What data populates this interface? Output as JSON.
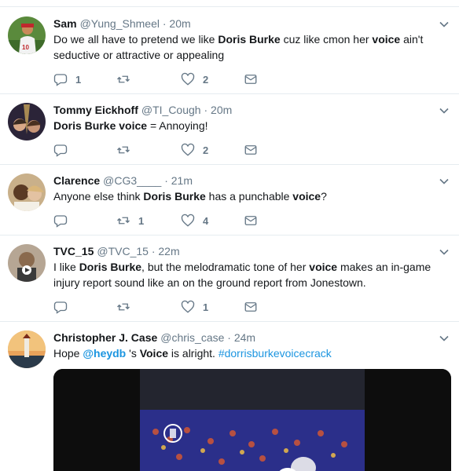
{
  "tweets": [
    {
      "name": "Sam",
      "handle": "@Yung_Shmeel",
      "time": "20m",
      "parts": [
        {
          "t": "Do we all have to pretend we like "
        },
        {
          "t": "Doris Burke",
          "b": true
        },
        {
          "t": " cuz like cmon her "
        },
        {
          "t": "voice",
          "b": true
        },
        {
          "t": " ain't seductive or attractive or appealing"
        }
      ],
      "replies": "1",
      "retweets": "",
      "likes": "2"
    },
    {
      "name": "Tommy Eickhoff",
      "handle": "@TI_Cough",
      "time": "20m",
      "parts": [
        {
          "t": "Doris Burke voice",
          "b": true
        },
        {
          "t": " = Annoying!"
        }
      ],
      "replies": "",
      "retweets": "",
      "likes": "2"
    },
    {
      "name": "Clarence",
      "handle": "@CG3____",
      "time": "21m",
      "parts": [
        {
          "t": "Anyone else think "
        },
        {
          "t": "Doris Burke",
          "b": true
        },
        {
          "t": " has a punchable "
        },
        {
          "t": "voice",
          "b": true
        },
        {
          "t": "?"
        }
      ],
      "replies": "",
      "retweets": "1",
      "likes": "4"
    },
    {
      "name": "TVC_15",
      "handle": "@TVC_15",
      "time": "22m",
      "parts": [
        {
          "t": "I like "
        },
        {
          "t": "Doris Burke",
          "b": true
        },
        {
          "t": ", but the melodramatic tone of her "
        },
        {
          "t": "voice",
          "b": true
        },
        {
          "t": " makes an in-game injury report sound like an on the ground report from Jonestown."
        }
      ],
      "replies": "",
      "retweets": "",
      "likes": "1"
    },
    {
      "name": "Christopher J. Case",
      "handle": "@chris_case",
      "time": "24m",
      "parts": [
        {
          "t": "Hope "
        },
        {
          "t": "@heydb",
          "b": true,
          "link": true
        },
        {
          "t": " 's "
        },
        {
          "t": "Voice",
          "b": true
        },
        {
          "t": " is alright. "
        },
        {
          "t": "#dorrisburkevoicecrack",
          "link": true
        }
      ],
      "replies": "",
      "retweets": "",
      "likes": ""
    }
  ],
  "colors": {
    "text": "#14171a",
    "secondary": "#657786",
    "link": "#1b95e0",
    "divider": "#e6ecf0"
  },
  "icons": {
    "reply": "reply-icon",
    "retweet": "retweet-icon",
    "like": "heart-icon",
    "dm": "envelope-icon",
    "menu": "chevron-down-icon"
  }
}
